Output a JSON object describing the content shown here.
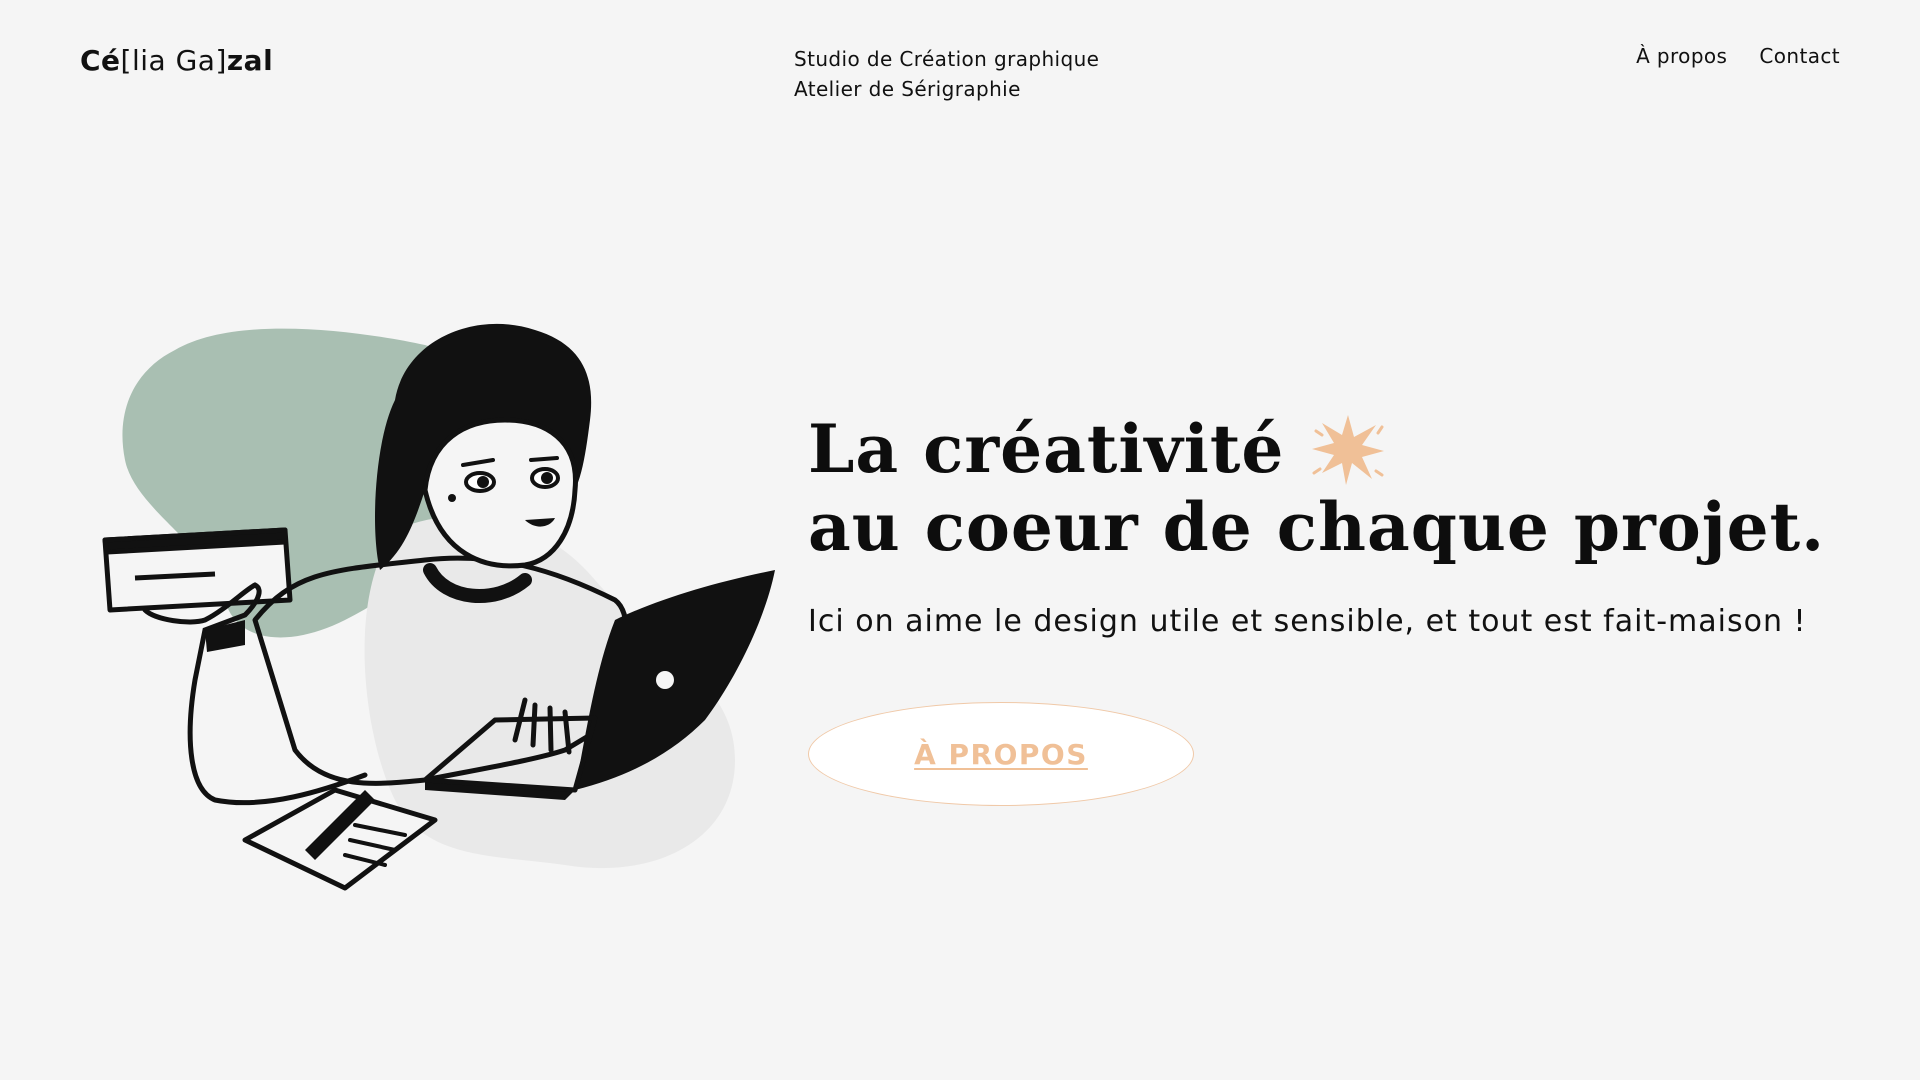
{
  "header": {
    "logo": {
      "part1": "Cé",
      "part2": "[lia Ga]",
      "part3": "zal"
    },
    "tagline": {
      "line1": "Studio de Création graphique",
      "line2": "Atelier de Sérigraphie"
    },
    "nav": {
      "about": "À propos",
      "contact": "Contact"
    }
  },
  "hero": {
    "headline_line1": "La créativité",
    "headline_line2": "au coeur de chaque projet.",
    "subtitle": "Ici on aime le design utile et sensible, et tout est fait-maison !",
    "cta_label": "À PROPOS"
  },
  "icons": {
    "sparkle": "sparkle-icon",
    "illustration": "woman-with-laptop-illustration"
  },
  "colors": {
    "background": "#f5f5f5",
    "accent": "#f0c097",
    "sage": "#a9bfb2",
    "text": "#111111"
  }
}
